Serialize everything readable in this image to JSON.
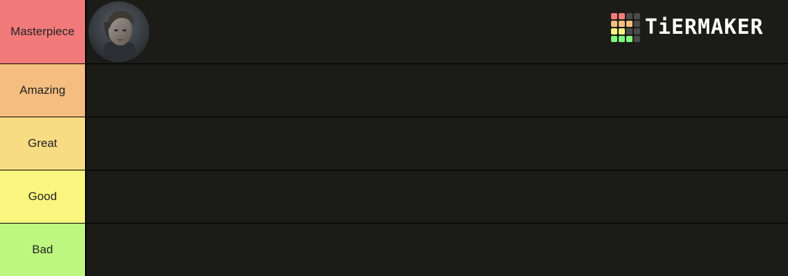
{
  "tiers": [
    {
      "label": "Masterpiece",
      "color": "#f27a7a"
    },
    {
      "label": "Amazing",
      "color": "#f5bd7f"
    },
    {
      "label": "Great",
      "color": "#f7dc84"
    },
    {
      "label": "Good",
      "color": "#f9f57e"
    },
    {
      "label": "Bad",
      "color": "#bdf77f"
    }
  ],
  "items": {
    "masterpiece": [
      {
        "name": "character-portrait"
      }
    ]
  },
  "logo": {
    "text": "TiERMAKER",
    "grid_colors": [
      "#f47c7c",
      "#f47c7c",
      "#4a4a4a",
      "#4a4a4a",
      "#f5bd7f",
      "#f5bd7f",
      "#f5bd7f",
      "#4a4a4a",
      "#f9f57e",
      "#f9f57e",
      "#4a4a4a",
      "#4a4a4a",
      "#7ff77f",
      "#7ff77f",
      "#7ff77f",
      "#4a4a4a"
    ]
  },
  "colors": {
    "row_background": "#1b1b17",
    "separator": "#000000"
  }
}
